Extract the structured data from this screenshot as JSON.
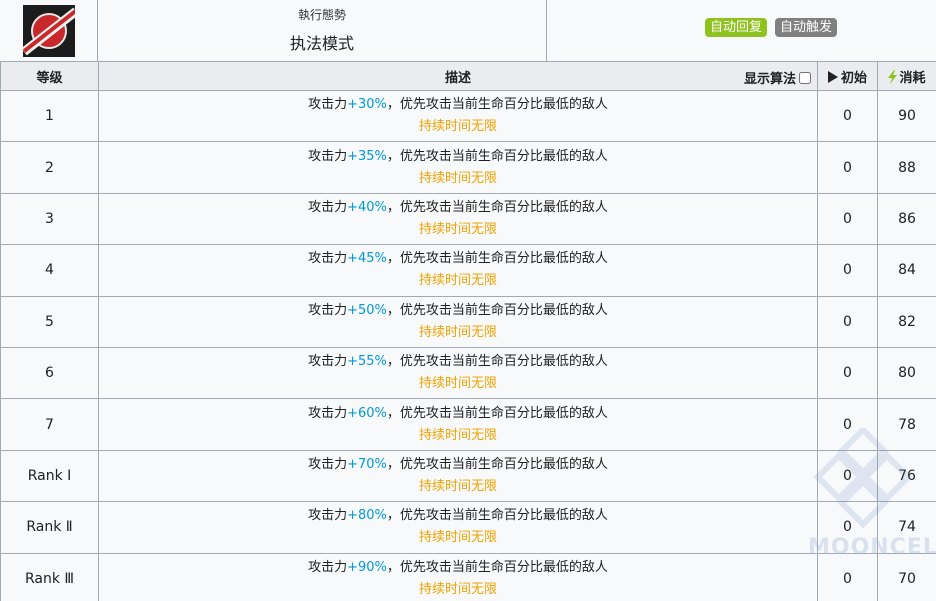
{
  "header": {
    "subtitle": "執行態勢",
    "title": "执法模式",
    "badges": [
      "自动回复",
      "自动触发"
    ]
  },
  "table": {
    "headers": {
      "level": "等级",
      "desc": "描述",
      "show_formula": "显示算法",
      "initial": "初始",
      "cost": "消耗"
    },
    "rows": [
      {
        "level": "1",
        "pre": "攻击力",
        "value": "+30%",
        "post": "，优先攻击当前生命百分比最低的敌人",
        "duration": "持续时间无限",
        "initial": "0",
        "cost": "90"
      },
      {
        "level": "2",
        "pre": "攻击力",
        "value": "+35%",
        "post": "，优先攻击当前生命百分比最低的敌人",
        "duration": "持续时间无限",
        "initial": "0",
        "cost": "88"
      },
      {
        "level": "3",
        "pre": "攻击力",
        "value": "+40%",
        "post": "，优先攻击当前生命百分比最低的敌人",
        "duration": "持续时间无限",
        "initial": "0",
        "cost": "86"
      },
      {
        "level": "4",
        "pre": "攻击力",
        "value": "+45%",
        "post": "，优先攻击当前生命百分比最低的敌人",
        "duration": "持续时间无限",
        "initial": "0",
        "cost": "84"
      },
      {
        "level": "5",
        "pre": "攻击力",
        "value": "+50%",
        "post": "，优先攻击当前生命百分比最低的敌人",
        "duration": "持续时间无限",
        "initial": "0",
        "cost": "82"
      },
      {
        "level": "6",
        "pre": "攻击力",
        "value": "+55%",
        "post": "，优先攻击当前生命百分比最低的敌人",
        "duration": "持续时间无限",
        "initial": "0",
        "cost": "80"
      },
      {
        "level": "7",
        "pre": "攻击力",
        "value": "+60%",
        "post": "，优先攻击当前生命百分比最低的敌人",
        "duration": "持续时间无限",
        "initial": "0",
        "cost": "78"
      },
      {
        "level": "Rank Ⅰ",
        "pre": "攻击力",
        "value": "+70%",
        "post": "，优先攻击当前生命百分比最低的敌人",
        "duration": "持续时间无限",
        "initial": "0",
        "cost": "76"
      },
      {
        "level": "Rank Ⅱ",
        "pre": "攻击力",
        "value": "+80%",
        "post": "，优先攻击当前生命百分比最低的敌人",
        "duration": "持续时间无限",
        "initial": "0",
        "cost": "74"
      },
      {
        "level": "Rank Ⅲ",
        "pre": "攻击力",
        "value": "+90%",
        "post": "，优先攻击当前生命百分比最低的敌人",
        "duration": "持续时间无限",
        "initial": "0",
        "cost": "70"
      }
    ]
  },
  "watermark": "MOONCELL",
  "colors": {
    "highlight": "#0098dc",
    "duration": "#f0a200",
    "badge_green": "#8ec31f",
    "badge_grey": "#808080",
    "bolt": "#8ec31f"
  },
  "icons": [
    "skill-icon",
    "play-icon",
    "bolt-icon"
  ]
}
